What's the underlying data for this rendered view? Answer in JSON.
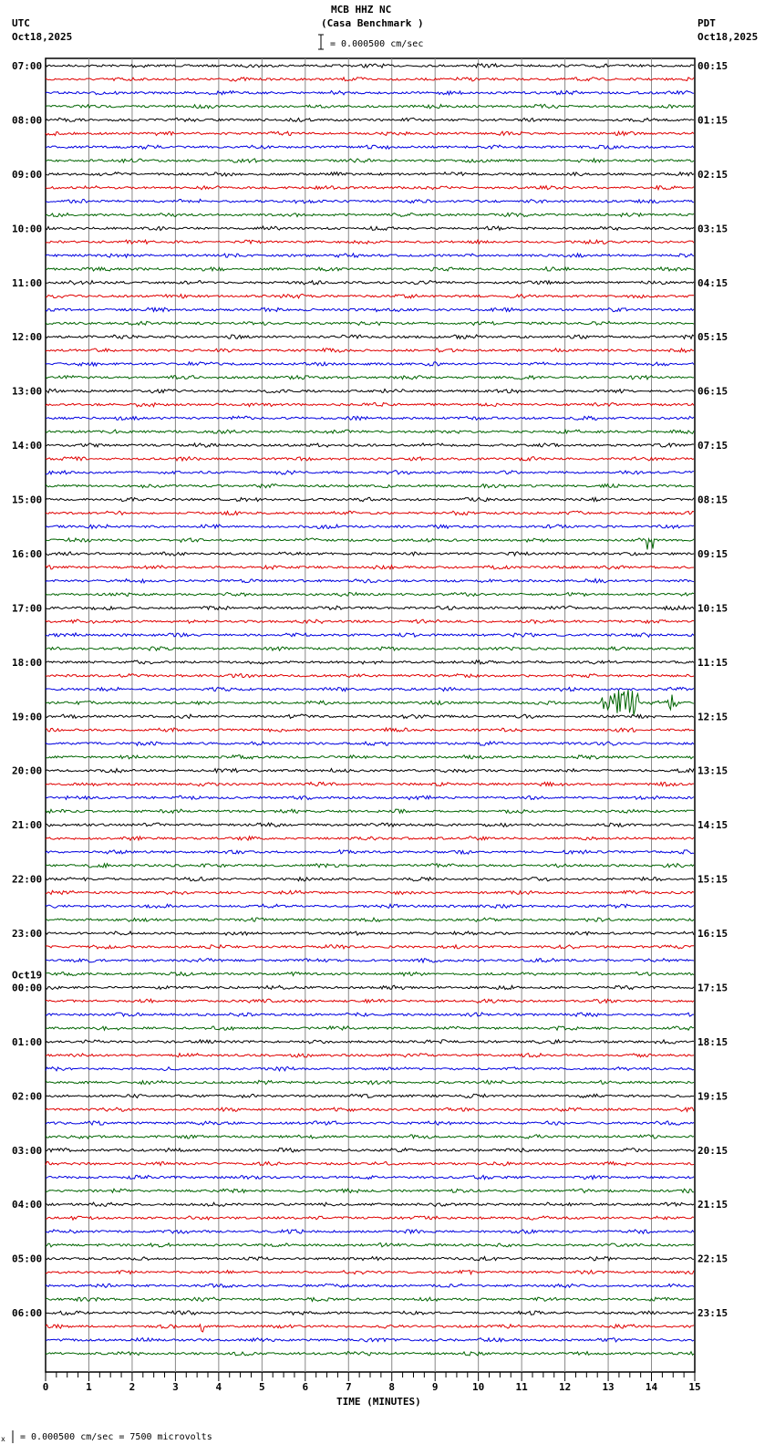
{
  "header": {
    "title": "MCB HHZ NC",
    "subtitle": "(Casa Benchmark )",
    "scale": "= 0.000500 cm/sec",
    "left_tz": "UTC",
    "left_date": "Oct18,2025",
    "right_tz": "PDT",
    "right_date": "Oct18,2025"
  },
  "footer": {
    "scale_note": "= 0.000500 cm/sec =    7500 microvolts",
    "marker": "x"
  },
  "chart_data": {
    "type": "line",
    "title": "MCB HHZ NC (Casa Benchmark )",
    "xlabel": "TIME (MINUTES)",
    "xlim": [
      0,
      15
    ],
    "xticks": [
      "0",
      "1",
      "2",
      "3",
      "4",
      "5",
      "6",
      "7",
      "8",
      "9",
      "10",
      "11",
      "12",
      "13",
      "14",
      "15"
    ],
    "trace_count": 96,
    "trace_minutes": 15,
    "colors": [
      "#000000",
      "#e00000",
      "#0000e0",
      "#006400"
    ],
    "left_labels": [
      {
        "row": 0,
        "text": "07:00"
      },
      {
        "row": 4,
        "text": "08:00"
      },
      {
        "row": 8,
        "text": "09:00"
      },
      {
        "row": 12,
        "text": "10:00"
      },
      {
        "row": 16,
        "text": "11:00"
      },
      {
        "row": 20,
        "text": "12:00"
      },
      {
        "row": 24,
        "text": "13:00"
      },
      {
        "row": 28,
        "text": "14:00"
      },
      {
        "row": 32,
        "text": "15:00"
      },
      {
        "row": 36,
        "text": "16:00"
      },
      {
        "row": 40,
        "text": "17:00"
      },
      {
        "row": 44,
        "text": "18:00"
      },
      {
        "row": 48,
        "text": "19:00"
      },
      {
        "row": 52,
        "text": "20:00"
      },
      {
        "row": 56,
        "text": "21:00"
      },
      {
        "row": 60,
        "text": "22:00"
      },
      {
        "row": 64,
        "text": "23:00"
      },
      {
        "row": 68,
        "text": "00:00",
        "date": "Oct19"
      },
      {
        "row": 72,
        "text": "01:00"
      },
      {
        "row": 76,
        "text": "02:00"
      },
      {
        "row": 80,
        "text": "03:00"
      },
      {
        "row": 84,
        "text": "04:00"
      },
      {
        "row": 88,
        "text": "05:00"
      },
      {
        "row": 92,
        "text": "06:00"
      }
    ],
    "right_labels": [
      "00:15",
      "01:15",
      "02:15",
      "03:15",
      "04:15",
      "05:15",
      "06:15",
      "07:15",
      "08:15",
      "09:15",
      "10:15",
      "11:15",
      "12:15",
      "13:15",
      "14:15",
      "15:15",
      "16:15",
      "17:15",
      "18:15",
      "19:15",
      "20:15",
      "21:15",
      "22:15",
      "23:15"
    ],
    "events": [
      {
        "row": 47,
        "start_min": 12.8,
        "end_min": 13.7,
        "amplitude": 4
      },
      {
        "row": 47,
        "start_min": 14.3,
        "end_min": 14.6,
        "amplitude": 1.5
      },
      {
        "row": 35,
        "start_min": 13.9,
        "end_min": 14.05,
        "amplitude": 2
      },
      {
        "row": 36,
        "start_min": 11.85,
        "end_min": 11.9,
        "amplitude": 1.5
      },
      {
        "row": 93,
        "start_min": 3.55,
        "end_min": 3.65,
        "amplitude": 2
      }
    ]
  }
}
